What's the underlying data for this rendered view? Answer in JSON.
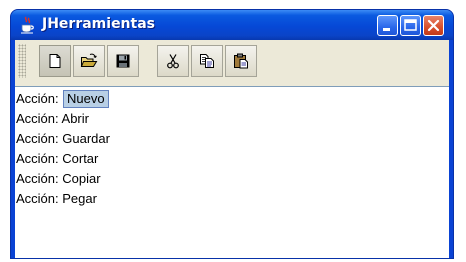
{
  "window": {
    "title": "JHerramientas",
    "icon": "java-coffee-cup-icon",
    "controls": [
      "minimize-icon",
      "maximize-icon",
      "close-icon"
    ]
  },
  "toolbar": {
    "buttons": [
      {
        "name": "new-file",
        "icon": "new-document-icon",
        "pressed": true
      },
      {
        "name": "open",
        "icon": "open-folder-icon",
        "pressed": false
      },
      {
        "name": "save",
        "icon": "floppy-disk-icon",
        "pressed": false
      },
      {
        "name": "cut",
        "icon": "scissors-icon",
        "pressed": false
      },
      {
        "name": "copy",
        "icon": "copy-icon",
        "pressed": false
      },
      {
        "name": "paste",
        "icon": "clipboard-icon",
        "pressed": false
      }
    ]
  },
  "log": {
    "lines": [
      "Acción: Nuevo",
      "Acción: Abrir",
      "Acción: Guardar",
      "Acción: Cortar",
      "Acción: Copiar",
      "Acción: Pegar"
    ]
  },
  "tooltip": {
    "text": "Nuevo"
  },
  "colors": {
    "titlebar": "#0648d6",
    "client": "#ece9d8",
    "tooltip_bg": "#b8cfe5"
  }
}
